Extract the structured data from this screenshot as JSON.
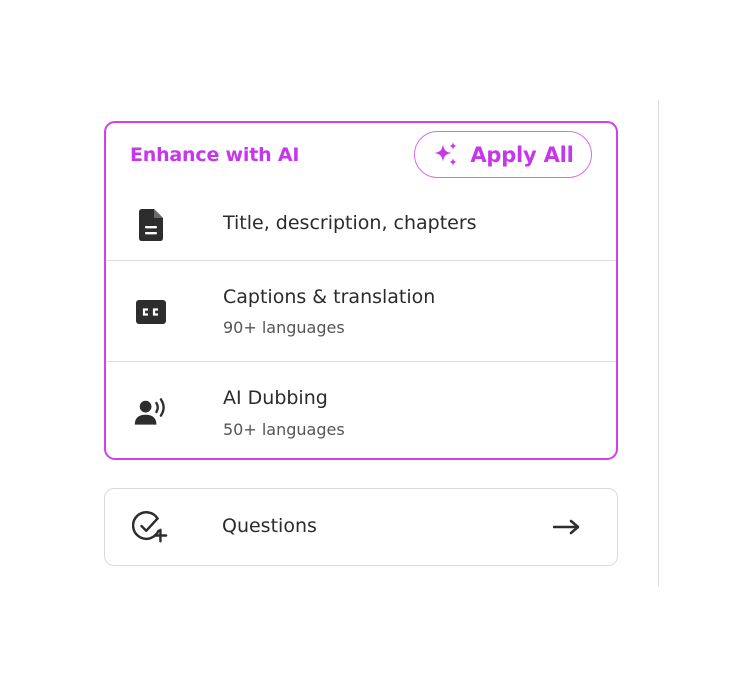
{
  "enhance_panel": {
    "title": "Enhance with AI",
    "apply_all_label": "Apply All",
    "apply_all_icon": "sparkle-icon",
    "items": [
      {
        "label": "Title, description, chapters",
        "sublabel": "",
        "icon": "document-icon"
      },
      {
        "label": "Captions & translation",
        "sublabel": "90+ languages",
        "icon": "closed-captions-icon"
      },
      {
        "label": "AI Dubbing",
        "sublabel": "50+ languages",
        "icon": "voice-speaker-icon"
      }
    ]
  },
  "questions_card": {
    "label": "Questions",
    "icon": "check-circle-plus-icon",
    "arrow_icon": "arrow-right-icon"
  },
  "colors": {
    "accent": "#c636ea",
    "accent_border": "#d23ef0",
    "text": "#2b2b2b",
    "subtext": "#555555",
    "icon": "#2d2d2d",
    "divider": "#dedede"
  }
}
